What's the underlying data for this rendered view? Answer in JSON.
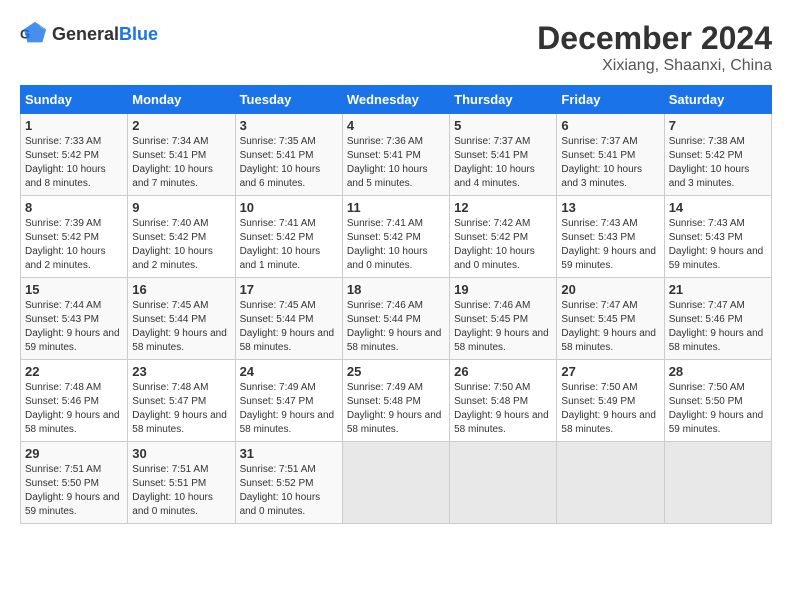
{
  "header": {
    "logo_general": "General",
    "logo_blue": "Blue",
    "title": "December 2024",
    "subtitle": "Xixiang, Shaanxi, China"
  },
  "columns": [
    "Sunday",
    "Monday",
    "Tuesday",
    "Wednesday",
    "Thursday",
    "Friday",
    "Saturday"
  ],
  "weeks": [
    [
      {
        "day": "1",
        "sunrise": "Sunrise: 7:33 AM",
        "sunset": "Sunset: 5:42 PM",
        "daylight": "Daylight: 10 hours and 8 minutes."
      },
      {
        "day": "2",
        "sunrise": "Sunrise: 7:34 AM",
        "sunset": "Sunset: 5:41 PM",
        "daylight": "Daylight: 10 hours and 7 minutes."
      },
      {
        "day": "3",
        "sunrise": "Sunrise: 7:35 AM",
        "sunset": "Sunset: 5:41 PM",
        "daylight": "Daylight: 10 hours and 6 minutes."
      },
      {
        "day": "4",
        "sunrise": "Sunrise: 7:36 AM",
        "sunset": "Sunset: 5:41 PM",
        "daylight": "Daylight: 10 hours and 5 minutes."
      },
      {
        "day": "5",
        "sunrise": "Sunrise: 7:37 AM",
        "sunset": "Sunset: 5:41 PM",
        "daylight": "Daylight: 10 hours and 4 minutes."
      },
      {
        "day": "6",
        "sunrise": "Sunrise: 7:37 AM",
        "sunset": "Sunset: 5:41 PM",
        "daylight": "Daylight: 10 hours and 3 minutes."
      },
      {
        "day": "7",
        "sunrise": "Sunrise: 7:38 AM",
        "sunset": "Sunset: 5:42 PM",
        "daylight": "Daylight: 10 hours and 3 minutes."
      }
    ],
    [
      {
        "day": "8",
        "sunrise": "Sunrise: 7:39 AM",
        "sunset": "Sunset: 5:42 PM",
        "daylight": "Daylight: 10 hours and 2 minutes."
      },
      {
        "day": "9",
        "sunrise": "Sunrise: 7:40 AM",
        "sunset": "Sunset: 5:42 PM",
        "daylight": "Daylight: 10 hours and 2 minutes."
      },
      {
        "day": "10",
        "sunrise": "Sunrise: 7:41 AM",
        "sunset": "Sunset: 5:42 PM",
        "daylight": "Daylight: 10 hours and 1 minute."
      },
      {
        "day": "11",
        "sunrise": "Sunrise: 7:41 AM",
        "sunset": "Sunset: 5:42 PM",
        "daylight": "Daylight: 10 hours and 0 minutes."
      },
      {
        "day": "12",
        "sunrise": "Sunrise: 7:42 AM",
        "sunset": "Sunset: 5:42 PM",
        "daylight": "Daylight: 10 hours and 0 minutes."
      },
      {
        "day": "13",
        "sunrise": "Sunrise: 7:43 AM",
        "sunset": "Sunset: 5:43 PM",
        "daylight": "Daylight: 9 hours and 59 minutes."
      },
      {
        "day": "14",
        "sunrise": "Sunrise: 7:43 AM",
        "sunset": "Sunset: 5:43 PM",
        "daylight": "Daylight: 9 hours and 59 minutes."
      }
    ],
    [
      {
        "day": "15",
        "sunrise": "Sunrise: 7:44 AM",
        "sunset": "Sunset: 5:43 PM",
        "daylight": "Daylight: 9 hours and 59 minutes."
      },
      {
        "day": "16",
        "sunrise": "Sunrise: 7:45 AM",
        "sunset": "Sunset: 5:44 PM",
        "daylight": "Daylight: 9 hours and 58 minutes."
      },
      {
        "day": "17",
        "sunrise": "Sunrise: 7:45 AM",
        "sunset": "Sunset: 5:44 PM",
        "daylight": "Daylight: 9 hours and 58 minutes."
      },
      {
        "day": "18",
        "sunrise": "Sunrise: 7:46 AM",
        "sunset": "Sunset: 5:44 PM",
        "daylight": "Daylight: 9 hours and 58 minutes."
      },
      {
        "day": "19",
        "sunrise": "Sunrise: 7:46 AM",
        "sunset": "Sunset: 5:45 PM",
        "daylight": "Daylight: 9 hours and 58 minutes."
      },
      {
        "day": "20",
        "sunrise": "Sunrise: 7:47 AM",
        "sunset": "Sunset: 5:45 PM",
        "daylight": "Daylight: 9 hours and 58 minutes."
      },
      {
        "day": "21",
        "sunrise": "Sunrise: 7:47 AM",
        "sunset": "Sunset: 5:46 PM",
        "daylight": "Daylight: 9 hours and 58 minutes."
      }
    ],
    [
      {
        "day": "22",
        "sunrise": "Sunrise: 7:48 AM",
        "sunset": "Sunset: 5:46 PM",
        "daylight": "Daylight: 9 hours and 58 minutes."
      },
      {
        "day": "23",
        "sunrise": "Sunrise: 7:48 AM",
        "sunset": "Sunset: 5:47 PM",
        "daylight": "Daylight: 9 hours and 58 minutes."
      },
      {
        "day": "24",
        "sunrise": "Sunrise: 7:49 AM",
        "sunset": "Sunset: 5:47 PM",
        "daylight": "Daylight: 9 hours and 58 minutes."
      },
      {
        "day": "25",
        "sunrise": "Sunrise: 7:49 AM",
        "sunset": "Sunset: 5:48 PM",
        "daylight": "Daylight: 9 hours and 58 minutes."
      },
      {
        "day": "26",
        "sunrise": "Sunrise: 7:50 AM",
        "sunset": "Sunset: 5:48 PM",
        "daylight": "Daylight: 9 hours and 58 minutes."
      },
      {
        "day": "27",
        "sunrise": "Sunrise: 7:50 AM",
        "sunset": "Sunset: 5:49 PM",
        "daylight": "Daylight: 9 hours and 58 minutes."
      },
      {
        "day": "28",
        "sunrise": "Sunrise: 7:50 AM",
        "sunset": "Sunset: 5:50 PM",
        "daylight": "Daylight: 9 hours and 59 minutes."
      }
    ],
    [
      {
        "day": "29",
        "sunrise": "Sunrise: 7:51 AM",
        "sunset": "Sunset: 5:50 PM",
        "daylight": "Daylight: 9 hours and 59 minutes."
      },
      {
        "day": "30",
        "sunrise": "Sunrise: 7:51 AM",
        "sunset": "Sunset: 5:51 PM",
        "daylight": "Daylight: 10 hours and 0 minutes."
      },
      {
        "day": "31",
        "sunrise": "Sunrise: 7:51 AM",
        "sunset": "Sunset: 5:52 PM",
        "daylight": "Daylight: 10 hours and 0 minutes."
      },
      null,
      null,
      null,
      null
    ]
  ]
}
